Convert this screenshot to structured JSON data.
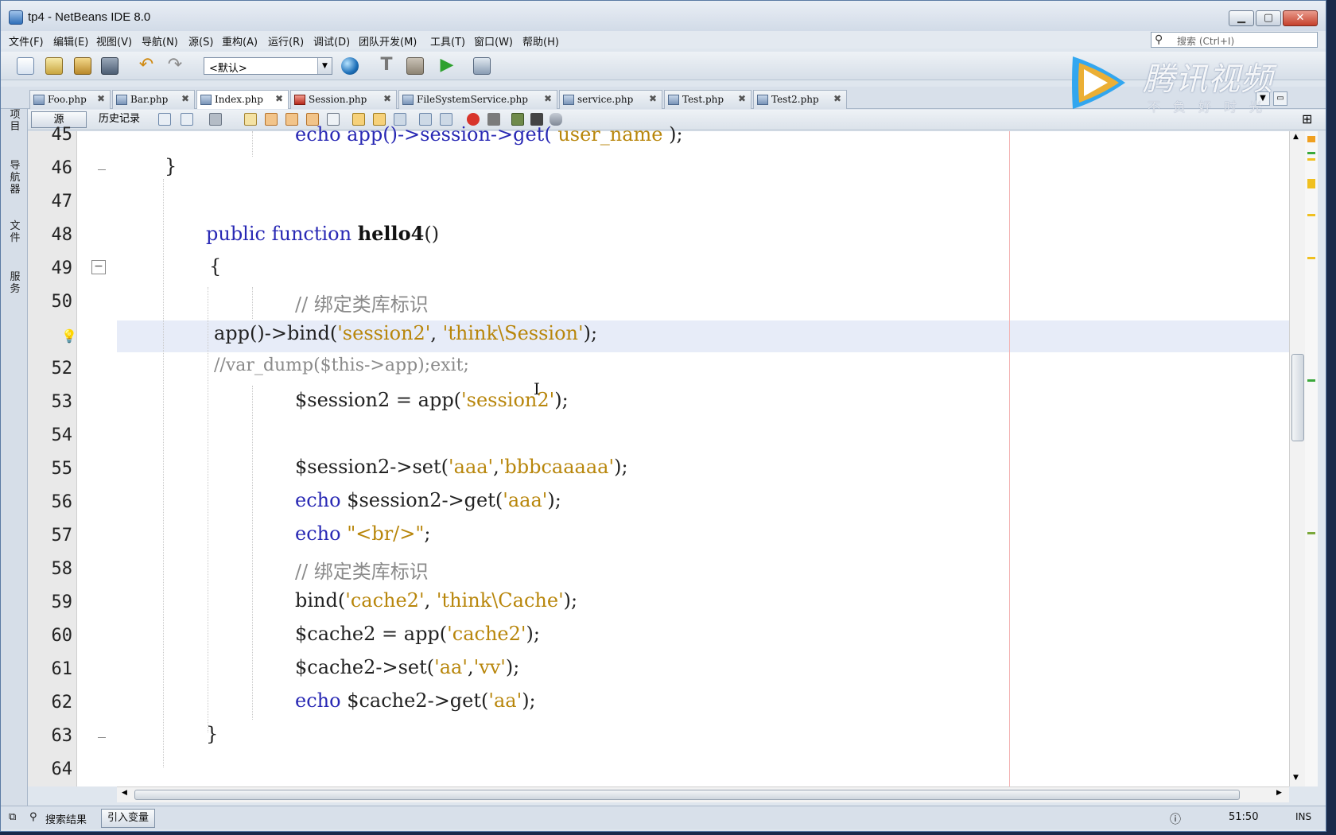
{
  "window": {
    "title": "tp4 - NetBeans IDE 8.0"
  },
  "menu": [
    {
      "label": "文件(F)"
    },
    {
      "label": "编辑(E)"
    },
    {
      "label": "视图(V)"
    },
    {
      "label": "导航(N)"
    },
    {
      "label": "源(S)"
    },
    {
      "label": "重构(A)"
    },
    {
      "label": "运行(R)"
    },
    {
      "label": "调试(D)"
    },
    {
      "label": "团队开发(M)"
    },
    {
      "label": "工具(T)"
    },
    {
      "label": "窗口(W)"
    },
    {
      "label": "帮助(H)"
    }
  ],
  "search": {
    "placeholder": "搜索 (Ctrl+I)"
  },
  "toolbar": {
    "config_value": "<默认>"
  },
  "tabs": [
    {
      "label": "Foo.php"
    },
    {
      "label": "Bar.php"
    },
    {
      "label": "Index.php"
    },
    {
      "label": "Session.php"
    },
    {
      "label": "FileSystemService.php"
    },
    {
      "label": "service.php"
    },
    {
      "label": "Test.php"
    },
    {
      "label": "Test2.php"
    }
  ],
  "editor_toolbar": {
    "source_label": "源",
    "history_label": "历史记录"
  },
  "side_panels": [
    {
      "label": "项目"
    },
    {
      "label": "导航器"
    },
    {
      "label": "文件"
    },
    {
      "label": "服务"
    }
  ],
  "code_lines": [
    {
      "num": "45",
      "t1": "echo app()->session->get( ",
      "t2": "user_name",
      "t3": " );"
    },
    {
      "num": "46",
      "text": "}"
    },
    {
      "num": "47",
      "text": ""
    },
    {
      "num": "48",
      "kw": "public function ",
      "fn": "hello4",
      "rest": "()"
    },
    {
      "num": "49",
      "text": "{"
    },
    {
      "num": "50",
      "comment": "// 绑定类库标识"
    },
    {
      "num": "",
      "a": "app()->bind(",
      "s1": "'session2'",
      "b": ", ",
      "s2": "'think\\Session'",
      "c": ");"
    },
    {
      "num": "52",
      "comment": "//var_dump($this->app);exit;"
    },
    {
      "num": "53",
      "a": "$session2 = app(",
      "s1": "'session2'",
      "c": ");"
    },
    {
      "num": "54",
      "text": ""
    },
    {
      "num": "55",
      "a": "$session2->set(",
      "s1": "'aaa'",
      "b": ",",
      "s2": "'bbbcaaaaa'",
      "c": ");"
    },
    {
      "num": "56",
      "kw": "echo ",
      "a": "$session2->get(",
      "s1": "'aaa'",
      "c": ");"
    },
    {
      "num": "57",
      "kw": "echo ",
      "s1": "\"<br/>\"",
      "c": ";"
    },
    {
      "num": "58",
      "comment": "// 绑定类库标识"
    },
    {
      "num": "59",
      "a": "bind(",
      "s1": "'cache2'",
      "b": ", ",
      "s2": "'think\\Cache'",
      "c": ");"
    },
    {
      "num": "60",
      "a": "$cache2 = app(",
      "s1": "'cache2'",
      "c": ");"
    },
    {
      "num": "61",
      "a": "$cache2->set(",
      "s1": "'aa'",
      "b": ",",
      "s2": "'vv'",
      "c": ");"
    },
    {
      "num": "62",
      "kw": "echo ",
      "a": "$cache2->get(",
      "s1": "'aa'",
      "c": ");"
    },
    {
      "num": "63",
      "text": "}"
    },
    {
      "num": "64",
      "text": ""
    }
  ],
  "status": {
    "search_results": "搜索结果",
    "introduce_variable": "引入变量",
    "position": "51:50",
    "insert_mode": "INS"
  },
  "watermark": {
    "brand": "腾讯视频",
    "slogan": "不负好时光"
  }
}
